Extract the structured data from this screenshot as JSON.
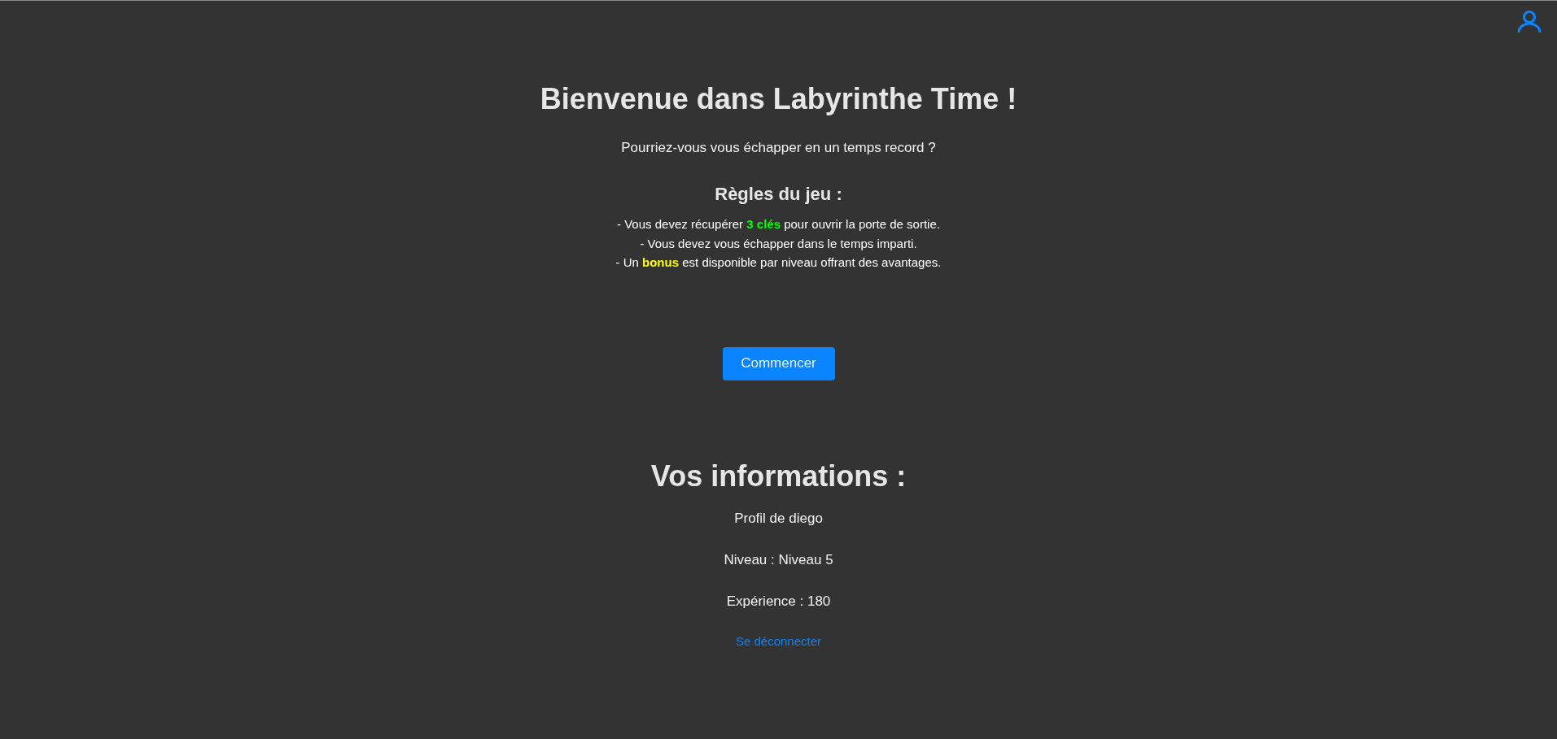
{
  "header": {
    "title": "Bienvenue dans Labyrinthe Time !",
    "subtitle": "Pourriez-vous vous échapper en un temps record ?"
  },
  "rules": {
    "heading": "Règles du jeu :",
    "lines": [
      [
        {
          "text": "- Vous devez récupérer "
        },
        {
          "text": "3 clés",
          "color": "#00ff00"
        },
        {
          "text": " pour ouvrir la porte de sortie."
        }
      ],
      [
        {
          "text": "- Vous devez vous échapper dans le temps imparti."
        }
      ],
      [
        {
          "text": "- Un "
        },
        {
          "text": "bonus",
          "color": "#ffff00"
        },
        {
          "text": " est disponible par niveau offrant des avantages."
        }
      ]
    ]
  },
  "start_button": "Commencer",
  "info": {
    "heading": "Vos informations :",
    "profile": "Profil de diego",
    "level": "Niveau : Niveau 5",
    "experience": "Expérience : 180",
    "logout_link": "Se déconnecter"
  }
}
